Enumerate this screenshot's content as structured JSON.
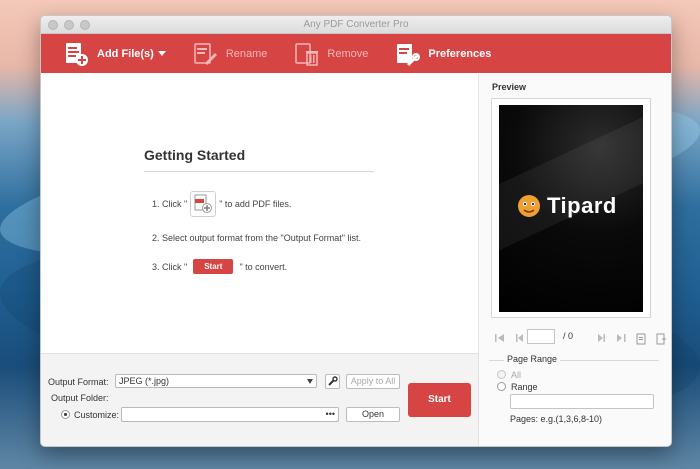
{
  "window": {
    "title": "Any PDF Converter Pro"
  },
  "toolbar": {
    "add_files": "Add File(s)",
    "rename": "Rename",
    "remove": "Remove",
    "preferences": "Preferences"
  },
  "getting_started": {
    "title": "Getting Started",
    "step1_prefix": "1. Click \"",
    "step1_suffix": "\" to add PDF files.",
    "step2": "2. Select output format from the \"Output Format\" list.",
    "step3_prefix": "3. Click \"",
    "step3_button": "Start",
    "step3_suffix": "\" to convert."
  },
  "output": {
    "format_label": "Output Format:",
    "format_value": "JPEG (*.jpg)",
    "apply_all": "Apply to All",
    "folder_label": "Output Folder:",
    "customize_label": "Customize:",
    "open_button": "Open",
    "browse_button": "•••",
    "start_button": "Start"
  },
  "preview": {
    "title": "Preview",
    "logo_text": "Tipard",
    "page_total": "/ 0",
    "page_range_title": "Page Range",
    "option_all": "All",
    "option_range": "Range",
    "pages_hint": "Pages: e.g.(1,3,6,8-10)"
  },
  "colors": {
    "accent": "#d74444",
    "toolbar_bg": "#d74444"
  }
}
